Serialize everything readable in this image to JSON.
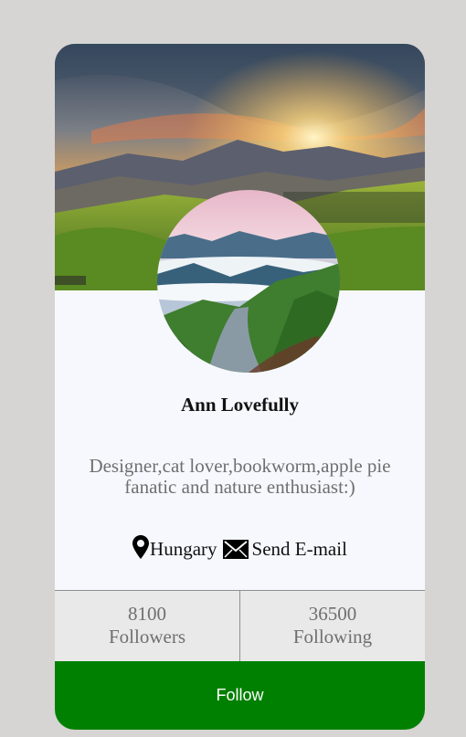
{
  "profile": {
    "name": "Ann Lovefully",
    "bio": "Designer,cat lover,bookworm,apple pie fanatic and nature enthusiast:)",
    "location": "Hungary",
    "email_label": "Send E-mail"
  },
  "stats": [
    {
      "value": "8100",
      "label": "Followers"
    },
    {
      "value": "36500",
      "label": "Following"
    }
  ],
  "actions": {
    "follow_label": "Follow"
  },
  "colors": {
    "follow_button": "#008000",
    "card_background": "#f7f8fe",
    "page_background": "#d6d5d3",
    "muted_text": "#6f6f6f"
  },
  "icons": {
    "location": "map-pin-icon",
    "email": "envelope-icon"
  }
}
